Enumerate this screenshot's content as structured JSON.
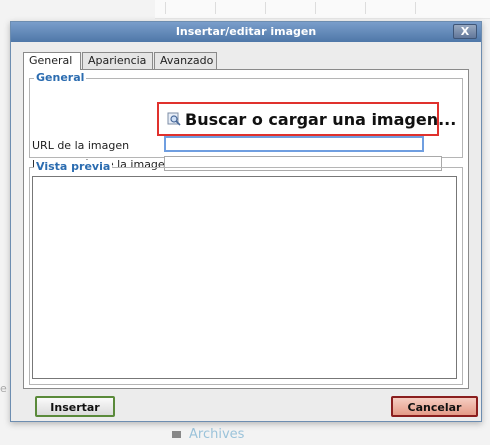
{
  "background": {
    "archives_label": "Archives",
    "edge_fragment": "e"
  },
  "dialog": {
    "title": "Insertar/editar imagen",
    "close_label": "X",
    "tabs": [
      {
        "label": "General",
        "active": true
      },
      {
        "label": "Apariencia",
        "active": false
      },
      {
        "label": "Avanzado",
        "active": false
      }
    ],
    "general": {
      "legend": "General",
      "search_link": "Buscar o cargar una imagen...",
      "url_label": "URL de la imagen",
      "url_value": "",
      "description_label": "Descripción de la imagen",
      "description_value": ""
    },
    "preview": {
      "legend": "Vista previa"
    },
    "buttons": {
      "insert": "Insertar",
      "cancel": "Cancelar"
    }
  },
  "colors": {
    "titlebar": "#5a81b3",
    "legend": "#2b6cb0",
    "highlight_box": "#e0312d",
    "insert_border": "#5a8a3a",
    "cancel_bg": "#e59a87"
  },
  "icons": {
    "search_link_icon": "image-search-icon",
    "close_icon": "close-icon",
    "folder_icon": "folder-icon"
  }
}
